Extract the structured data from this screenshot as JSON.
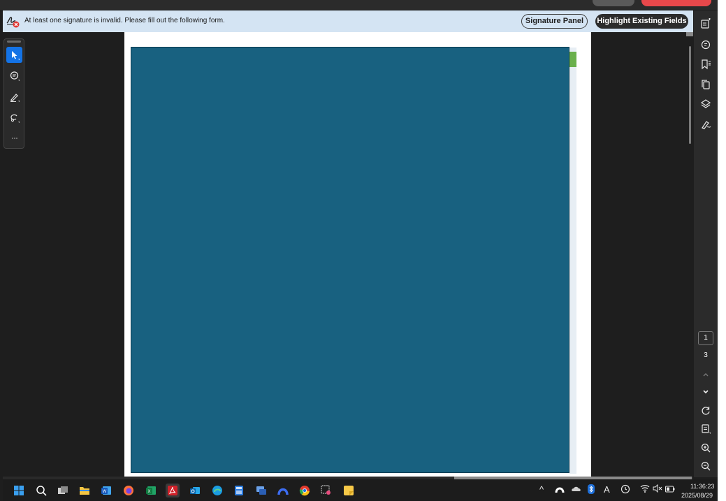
{
  "notification": {
    "message": "At least one signature is invalid.  Please fill out the following form.",
    "signature_panel_label": "Signature Panel",
    "highlight_fields_label": "Highlight Existing Fields"
  },
  "left_tools": [
    {
      "name": "select-tool",
      "icon": "arrow-cursor-icon",
      "active": true
    },
    {
      "name": "comment-tool",
      "icon": "comment-icon",
      "active": false
    },
    {
      "name": "draw-tool",
      "icon": "pen-icon",
      "active": false
    },
    {
      "name": "lasso-tool",
      "icon": "lasso-icon",
      "active": false
    },
    {
      "name": "more-tools",
      "icon": "more-icon",
      "active": false
    }
  ],
  "more_tools_glyph": "···",
  "right_panel": {
    "icons": [
      "edit-pdf-icon",
      "comment-icon",
      "bookmark-icon",
      "pages-icon",
      "layers-icon",
      "fill-sign-icon"
    ],
    "current_page": "1",
    "total_pages": "3",
    "nav_icons": [
      "page-up-icon",
      "page-down-icon",
      "refresh-icon",
      "page-fit-icon",
      "zoom-in-icon",
      "zoom-out-icon"
    ]
  },
  "colors": {
    "accent": "#1473e6",
    "overlay": "#186180",
    "notification_bg": "#d4e4f3",
    "green_tab": "#6ab04c"
  },
  "taskbar": {
    "apps": [
      "start-icon",
      "search-icon",
      "task-view-icon",
      "file-explorer-icon",
      "word-icon",
      "firefox-icon",
      "excel-icon",
      "acrobat-icon",
      "outlook-icon",
      "edge-icon",
      "calculator-icon",
      "remote-desktop-icon",
      "arc-icon",
      "chrome-icon",
      "snipping-tool-icon",
      "sticky-notes-icon"
    ],
    "tray": [
      "chevron-up-icon",
      "app-tray-icon",
      "onedrive-icon",
      "bluetooth-icon",
      "font-icon",
      "clock-icon",
      "wifi-icon",
      "volume-mute-icon",
      "battery-icon"
    ],
    "tray_font_glyph": "A",
    "time": "11:36:23",
    "date": "2025/08/29"
  }
}
